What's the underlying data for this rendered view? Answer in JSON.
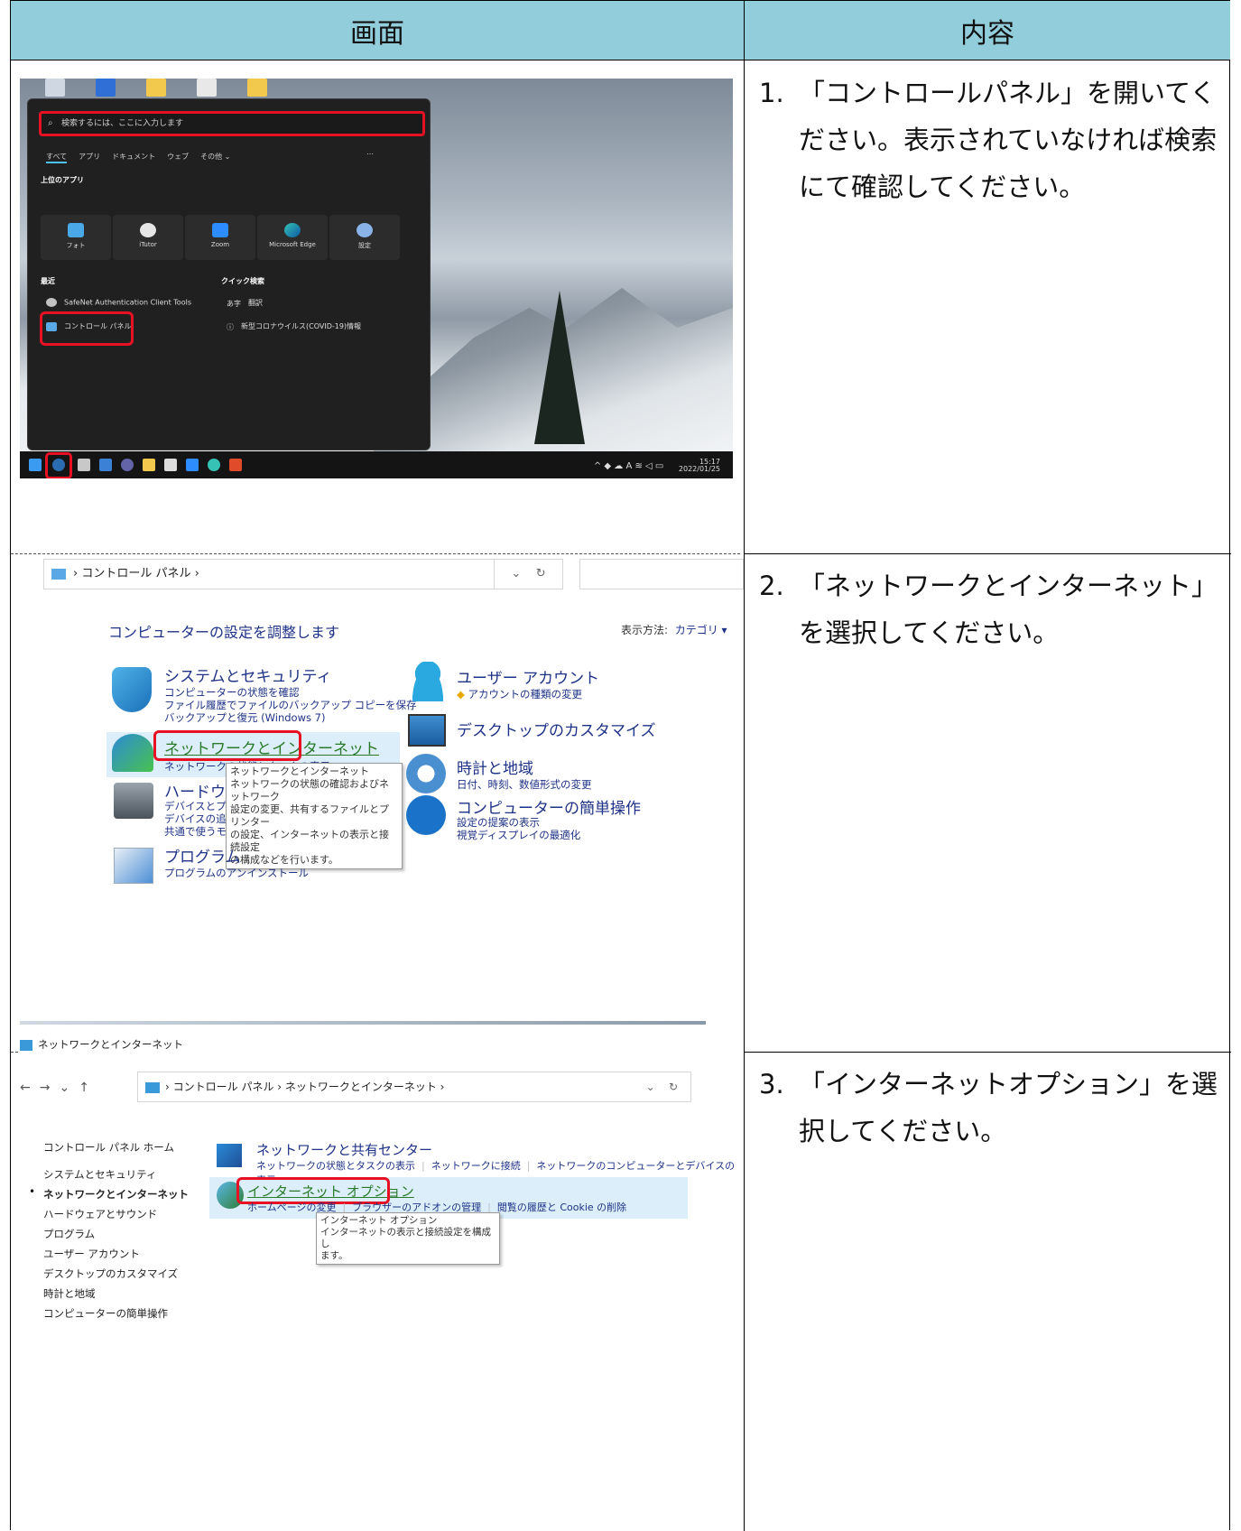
{
  "table": {
    "header_screen": "画面",
    "header_content": "内容"
  },
  "steps": [
    {
      "num": "1.",
      "text": "「コントロールパネル」を開いてください。表示されていなければ検索にて確認してください。"
    },
    {
      "num": "2.",
      "text": "「ネットワークとインターネット」を選択してください。"
    },
    {
      "num": "3.",
      "text": "「インターネットオプション」を選択してください。"
    }
  ],
  "start_menu": {
    "search_placeholder": "検索するには、ここに入力します",
    "tabs": [
      "すべて",
      "アプリ",
      "ドキュメント",
      "ウェブ",
      "その他 ⌄"
    ],
    "pinned_label": "上位のアプリ",
    "apps": [
      "フォト",
      "iTutor",
      "Zoom",
      "Microsoft Edge",
      "設定"
    ],
    "recent_label": "最近",
    "recent_items": [
      "SafeNet Authentication Client Tools",
      "コントロール パネル"
    ],
    "quick_label": "クイック検索",
    "quick_items": [
      "翻訳",
      "新型コロナウイルス(COVID-19)情報"
    ],
    "clock_time": "15:17",
    "clock_date": "2022/01/25",
    "colors": {
      "highlight": "#e81123",
      "header_bg": "#92cddc"
    }
  },
  "control_panel": {
    "address": "コントロール パネル  ›",
    "title": "コンピューターの設定を調整します",
    "view_by_label": "表示方法:",
    "view_by_value": "カテゴリ ▾",
    "categories_left": [
      {
        "title": "システムとセキュリティ",
        "links": [
          "コンピューターの状態を確認",
          "ファイル履歴でファイルのバックアップ コピーを保存",
          "バックアップと復元 (Windows 7)"
        ]
      },
      {
        "title": "ネットワークとインターネット",
        "links": [
          "ネットワークの状態とタスクの表示"
        ]
      },
      {
        "title": "ハードウェアとサウンド",
        "links": [
          "デバイスとプリンターの表示",
          "デバイスの追加",
          "共通で使うモビリティ設定の調整"
        ]
      },
      {
        "title": "プログラム",
        "links": [
          "プログラムのアンインストール"
        ]
      }
    ],
    "categories_right": [
      {
        "title": "ユーザー アカウント",
        "links": [
          "アカウントの種類の変更"
        ]
      },
      {
        "title": "デスクトップのカスタマイズ",
        "links": []
      },
      {
        "title": "時計と地域",
        "links": [
          "日付、時刻、数値形式の変更"
        ]
      },
      {
        "title": "コンピューターの簡単操作",
        "links": [
          "設定の提案の表示",
          "視覚ディスプレイの最適化"
        ]
      }
    ],
    "tooltip": [
      "ネットワークとインターネット",
      "ネットワークの状態の確認およびネットワーク",
      "設定の変更、共有するファイルとプリンター",
      "の設定、インターネットの表示と接続設定",
      "の構成などを行います。"
    ]
  },
  "network_page": {
    "window_title": "ネットワークとインターネット",
    "address": "コントロール パネル  ›  ネットワークとインターネット  ›",
    "sidebar": [
      "コントロール パネル ホーム",
      "システムとセキュリティ",
      "ネットワークとインターネット",
      "ハードウェアとサウンド",
      "プログラム",
      "ユーザー アカウント",
      "デスクトップのカスタマイズ",
      "時計と地域",
      "コンピューターの簡単操作"
    ],
    "section1_title": "ネットワークと共有センター",
    "section1_links": [
      "ネットワークの状態とタスクの表示",
      "ネットワークに接続",
      "ネットワークのコンピューターとデバイスの表示"
    ],
    "section2_title": "インターネット オプション",
    "section2_links": [
      "ホームページの変更",
      "ブラウザーのアドオンの管理",
      "閲覧の履歴と Cookie の削除"
    ],
    "tooltip": [
      "インターネット オプション",
      "インターネットの表示と接続設定を構成し",
      "ます。"
    ]
  }
}
